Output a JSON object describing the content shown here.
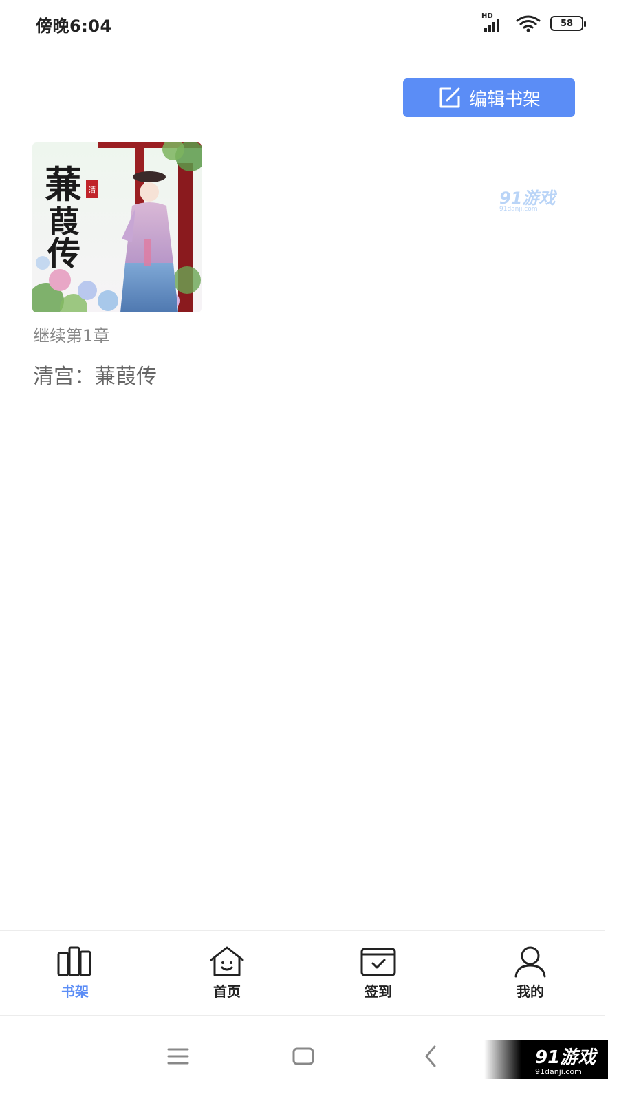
{
  "status_bar": {
    "time": "傍晚6:04",
    "network": "HD",
    "battery": "58"
  },
  "toolbar": {
    "edit_label": "编辑书架"
  },
  "watermark": {
    "brand": "91游戏",
    "domain": "91danji.com"
  },
  "shelf": {
    "books": [
      {
        "progress": "继续第1章",
        "title": "清宫：蒹葭传",
        "cover_text": "蒹葭传"
      }
    ]
  },
  "tabs": [
    {
      "label": "书架",
      "icon": "bookshelf-icon",
      "active": true
    },
    {
      "label": "首页",
      "icon": "home-icon",
      "active": false
    },
    {
      "label": "签到",
      "icon": "checkin-icon",
      "active": false
    },
    {
      "label": "我的",
      "icon": "user-icon",
      "active": false
    }
  ],
  "colors": {
    "accent": "#5b8df6",
    "tab_text": "#222222",
    "muted_text": "#888888"
  }
}
